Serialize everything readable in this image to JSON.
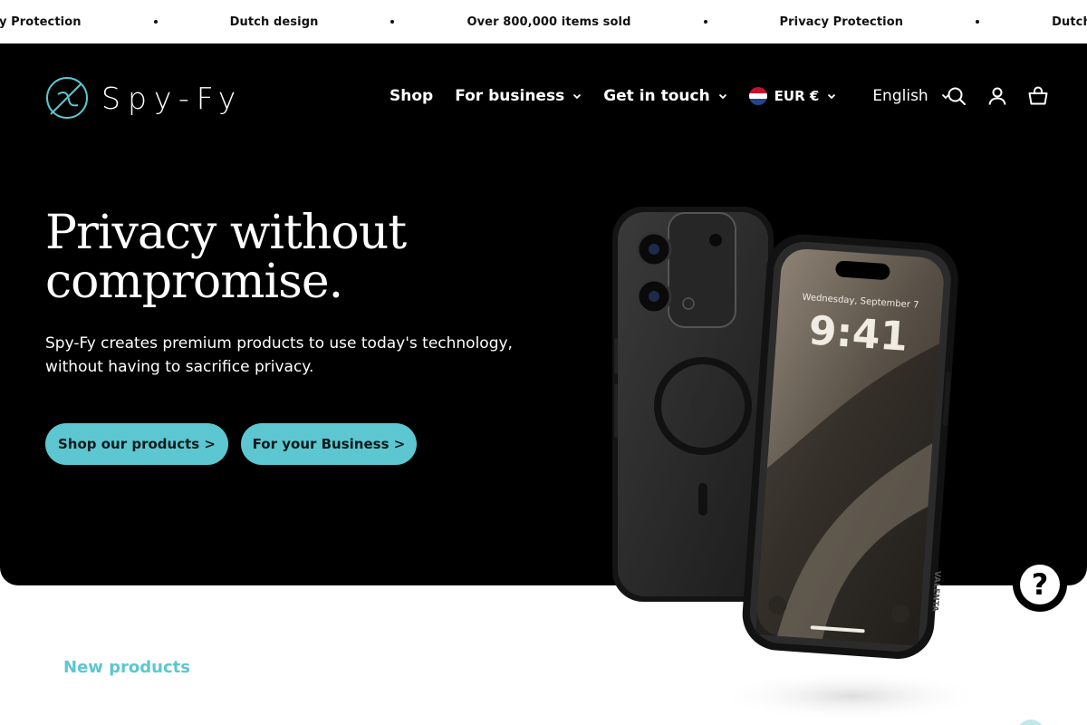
{
  "announcement": {
    "items": [
      "Privacy Protection",
      "Dutch design",
      "Over 800,000 items sold",
      "Privacy Protection",
      "Dutch design"
    ]
  },
  "header": {
    "logo_text": "Spy-Fy",
    "nav": [
      {
        "label": "Shop",
        "has_dropdown": false
      },
      {
        "label": "For business",
        "has_dropdown": true
      },
      {
        "label": "Get in touch",
        "has_dropdown": true
      }
    ],
    "currency": "EUR €",
    "language": "English",
    "icons": [
      "search-icon",
      "account-icon",
      "cart-icon"
    ]
  },
  "hero": {
    "title": "Privacy without compromise.",
    "subtitle": "Spy-Fy creates premium products to use today's technology, without having to sacrifice privacy.",
    "buttons": [
      {
        "label": "Shop our products >"
      },
      {
        "label": "For your Business >"
      }
    ],
    "phone_screen": {
      "date": "Wednesday, September 7",
      "time": "9:41"
    },
    "case_brand": "VALENTA"
  },
  "sections": {
    "new_products_label": "New products"
  },
  "help_widget": {
    "symbol": "?"
  },
  "colors": {
    "accent": "#5cc7d0",
    "hero_bg": "#000000",
    "page_bg": "#ffffff"
  }
}
